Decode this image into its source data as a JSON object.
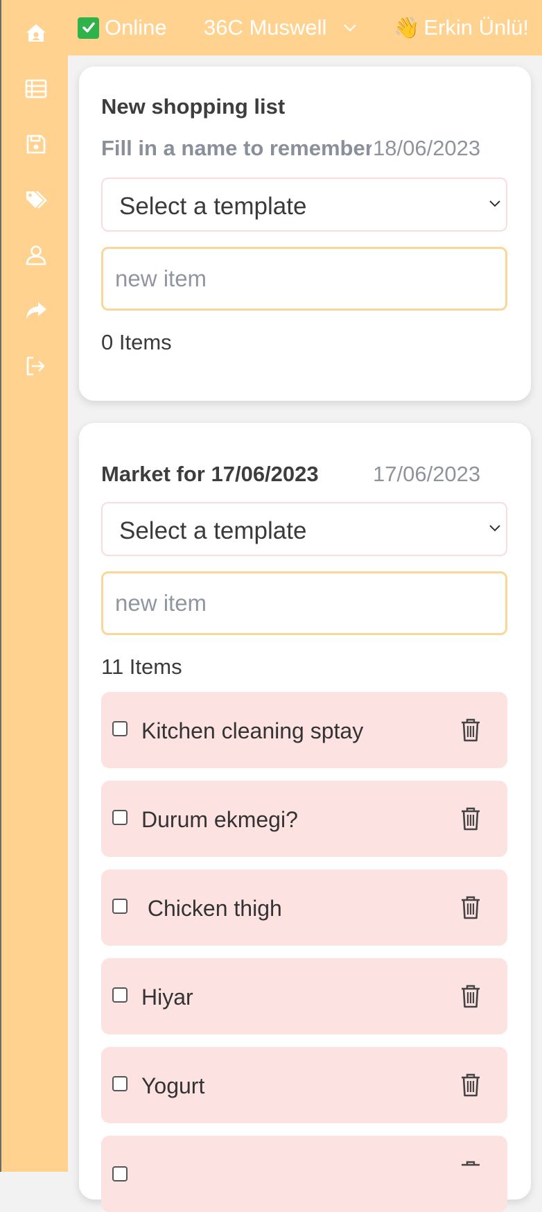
{
  "topbar": {
    "status_label": "Online",
    "household_label": "36C Muswell",
    "user_label": "Erkin Ünlü!"
  },
  "sidebar": {
    "items": [
      {
        "icon": "home-icon"
      },
      {
        "icon": "list-icon"
      },
      {
        "icon": "save-icon"
      },
      {
        "icon": "tags-icon"
      },
      {
        "icon": "user-icon"
      },
      {
        "icon": "share-icon"
      },
      {
        "icon": "logout-icon"
      }
    ]
  },
  "new_list": {
    "title": "New shopping list",
    "name_placeholder": "Fill in a name to remember",
    "date": "18/06/2023",
    "template_select": "Select a template",
    "item_placeholder": "new item",
    "count": "0 Items"
  },
  "market_list": {
    "title": "Market for 17/06/2023",
    "date": "17/06/2023",
    "template_select": "Select a template",
    "item_placeholder": "new item",
    "count": "11 Items",
    "items": [
      {
        "label": "Kitchen cleaning sptay",
        "checked": false
      },
      {
        "label": "Durum ekmegi?",
        "checked": false
      },
      {
        "label": " Chicken thigh",
        "checked": false
      },
      {
        "label": "Hiyar",
        "checked": false
      },
      {
        "label": "Yogurt",
        "checked": false
      }
    ]
  },
  "colors": {
    "accent": "#ffd28f",
    "row_bg": "#fde2e2",
    "input_border": "#fbd699"
  }
}
